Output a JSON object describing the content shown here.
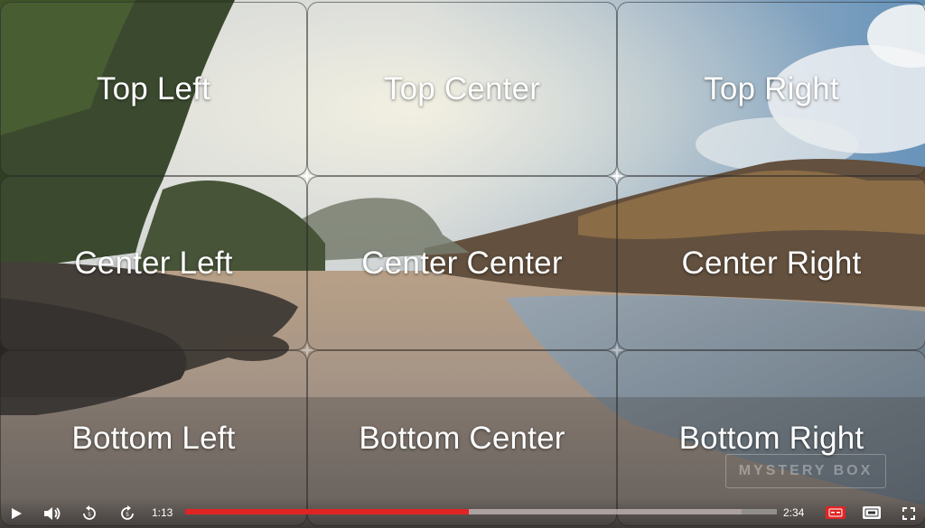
{
  "grid": {
    "cells": [
      {
        "label": "Top Left"
      },
      {
        "label": "Top Center"
      },
      {
        "label": "Top Right"
      },
      {
        "label": "Center Left"
      },
      {
        "label": "Center Center"
      },
      {
        "label": "Center Right"
      },
      {
        "label": "Bottom Left"
      },
      {
        "label": "Bottom Center"
      },
      {
        "label": "Bottom Right"
      }
    ]
  },
  "watermark": "MYSTERY BOX",
  "controls": {
    "current_time": "1:13",
    "duration": "2:34",
    "progress_fraction": 0.48,
    "buffered_fraction": 0.94,
    "icons": [
      "play-icon",
      "volume-icon",
      "rewind-icon",
      "forward-icon",
      "subtitles-icon",
      "hd-icon",
      "fullscreen-icon"
    ]
  },
  "colors": {
    "progress_played": "#e02424",
    "subtitles_badge": "#e02424"
  }
}
